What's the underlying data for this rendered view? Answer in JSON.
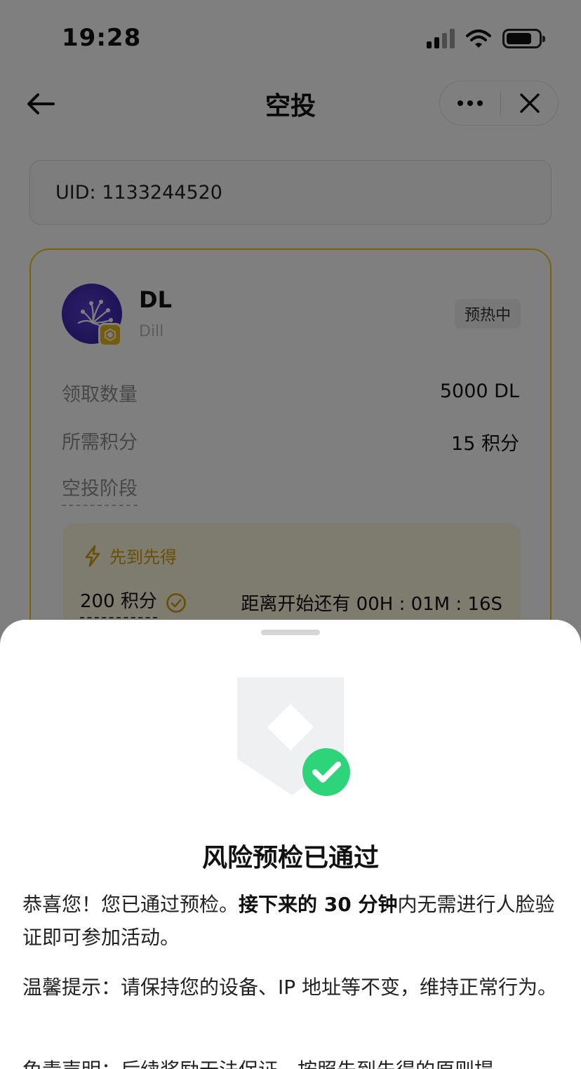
{
  "status_bar": {
    "time": "19:28"
  },
  "nav": {
    "title": "空投"
  },
  "uid": "UID: 1133244520",
  "project": {
    "name": "DL",
    "sub": "Dill",
    "tag": "预热中",
    "rows": [
      {
        "label": "领取数量",
        "value": "5000 DL"
      },
      {
        "label": "所需积分",
        "value": "15 积分"
      }
    ],
    "phase_label": "空投阶段",
    "phase": {
      "title": "先到先得",
      "points": "200 积分",
      "countdown": "距离开始还有 00H : 01M : 16S"
    }
  },
  "sheet": {
    "title": "风险预检已通过",
    "para1_a": "恭喜您！您已通过预检。",
    "para1_b": "接下来的 30 分钟",
    "para1_c": "内无需进行人脸验证即可参加活动。",
    "para2": "温馨提示：请保持您的设备、IP 地址等不变，维持正常行为。",
    "para3": "免责声明：后续奖励无法保证，按照先到先得的原则提"
  },
  "colors": {
    "accent_yellow": "#f3c614",
    "success_green": "#2ed47a",
    "overlay": "rgba(0,0,0,0.5)",
    "phase_title": "#d19e0c"
  },
  "icons": {
    "back": "arrow-left-icon",
    "more": "more-dots-icon",
    "close": "close-icon",
    "chain": "bnb-chain-icon",
    "lightning": "lightning-icon",
    "check": "check-circle-icon",
    "shield": "shield-check-icon"
  }
}
